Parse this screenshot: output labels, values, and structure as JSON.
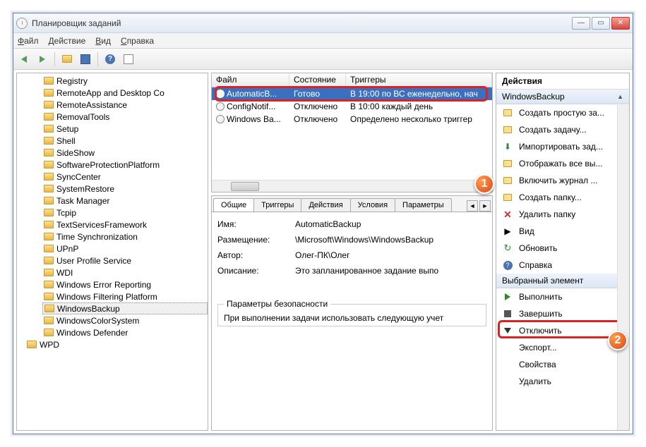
{
  "title": "Планировщик заданий",
  "menu": {
    "file": "Файл",
    "action": "Действие",
    "view": "Вид",
    "help": "Справка"
  },
  "tree": [
    "Registry",
    "RemoteApp and Desktop Co",
    "RemoteAssistance",
    "RemovalTools",
    "Setup",
    "Shell",
    "SideShow",
    "SoftwareProtectionPlatform",
    "SyncCenter",
    "SystemRestore",
    "Task Manager",
    "Tcpip",
    "TextServicesFramework",
    "Time Synchronization",
    "UPnP",
    "User Profile Service",
    "WDI",
    "Windows Error Reporting",
    "Windows Filtering Platform",
    "WindowsBackup",
    "WindowsColorSystem",
    "Windows Defender"
  ],
  "treeOut": "WPD",
  "treeSelected": "WindowsBackup",
  "taskHdr": {
    "file": "Файл",
    "state": "Состояние",
    "triggers": "Триггеры"
  },
  "tasks": [
    {
      "name": "AutomaticB...",
      "state": "Готово",
      "trig": "В 19:00 по ВС еженедельно, нач"
    },
    {
      "name": "ConfigNotif...",
      "state": "Отключено",
      "trig": "В 10:00 каждый день"
    },
    {
      "name": "Windows Ba...",
      "state": "Отключено",
      "trig": "Определено несколько триггер"
    }
  ],
  "tabs": [
    "Общие",
    "Триггеры",
    "Действия",
    "Условия",
    "Параметры"
  ],
  "detail": {
    "nameLbl": "Имя:",
    "nameVal": "AutomaticBackup",
    "locLbl": "Размещение:",
    "locVal": "\\Microsoft\\Windows\\WindowsBackup",
    "authLbl": "Автор:",
    "authVal": "Олег-ПК\\Олег",
    "descLbl": "Описание:",
    "descVal": "Это запланированное задание выпо",
    "secLbl": "Параметры безопасности",
    "secTxt": "При выполнении задачи использовать следующую учет"
  },
  "actions": {
    "hdr": "Действия",
    "group1": "WindowsBackup",
    "items1": [
      "Создать простую за...",
      "Создать задачу...",
      "Импортировать зад...",
      "Отображать все вы...",
      "Включить журнал ...",
      "Создать папку...",
      "Удалить папку",
      "Вид",
      "Обновить",
      "Справка"
    ],
    "group2": "Выбранный элемент",
    "items2": [
      "Выполнить",
      "Завершить",
      "Отключить",
      "Экспорт...",
      "Свойства",
      "Удалить"
    ]
  }
}
